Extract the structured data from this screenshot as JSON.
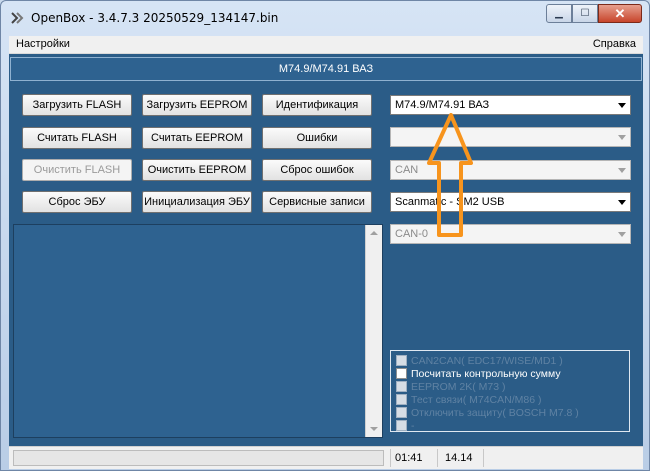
{
  "window": {
    "title": "OpenBox - 3.4.7.3 20250529_134147.bin"
  },
  "menu": {
    "settings": "Настройки",
    "help": "Справка"
  },
  "header": {
    "ecu_title": "M74.9/M74.91 ВАЗ"
  },
  "buttons": {
    "load_flash": "Загрузить FLASH",
    "load_eeprom": "Загрузить EEPROM",
    "identification": "Идентификация",
    "read_flash": "Считать FLASH",
    "read_eeprom": "Считать EEPROM",
    "errors": "Ошибки",
    "clear_flash": "Очистить FLASH",
    "clear_eeprom": "Очистить EEPROM",
    "reset_errors": "Сброс ошибок",
    "reset_ecu": "Сброс ЭБУ",
    "init_ecu": "Инициализация ЭБУ",
    "service_records": "Сервисные записи"
  },
  "combos": {
    "ecu_model": "M74.9/M74.91 ВАЗ",
    "empty": "",
    "protocol": "CAN",
    "adapter": "Scanmatic - SM2 USB",
    "channel": "CAN-0"
  },
  "options": [
    {
      "label": "CAN2CAN( EDC17/WISE/MD1 )",
      "enabled": false,
      "checked": false
    },
    {
      "label": "Посчитать контрольную сумму",
      "enabled": true,
      "checked": false
    },
    {
      "label": "EEPROM 2K( M73 )",
      "enabled": false,
      "checked": false
    },
    {
      "label": "Тест связи( M74CAN/M86 )",
      "enabled": false,
      "checked": false
    },
    {
      "label": "Отключить защиту( BOSCH M7.8 )",
      "enabled": false,
      "checked": false
    },
    {
      "label": "-",
      "enabled": false,
      "checked": false
    }
  ],
  "status": {
    "time": "01:41",
    "voltage": "14.14",
    "progress": 0
  },
  "colors": {
    "client_bg": "#2b5c87",
    "annotation_arrow": "#f7941d"
  }
}
